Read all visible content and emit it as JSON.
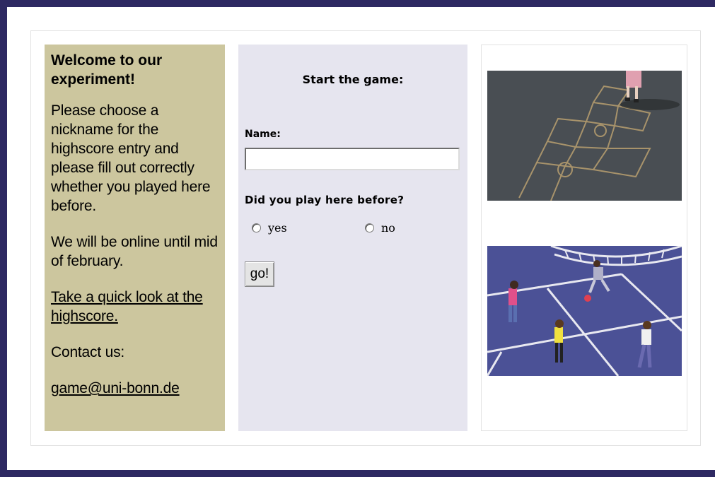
{
  "sidebar": {
    "welcome_title": "Welcome to our experiment!",
    "intro_text": "Please choose a nickname for the highscore entry and please fill out correctly whether you played here before.",
    "online_text": "We will be online until mid of february.",
    "highscore_link": "Take a quick look at the highscore.",
    "contact_label": "Contact us:",
    "contact_email": "game@uni-bonn.de"
  },
  "form": {
    "title": "Start the game:",
    "name_label": "Name:",
    "name_value": "",
    "played_before_label": "Did you play here before?",
    "options": [
      {
        "label": "yes",
        "checked": false
      },
      {
        "label": "no",
        "checked": false
      }
    ],
    "submit_label": "go!"
  },
  "images": {
    "top_description": "hopscotch-chalk-photo",
    "bottom_description": "children-playground-photo"
  },
  "colors": {
    "frame": "#2e2962",
    "sidebar_bg": "#ccc69e",
    "form_bg": "#e6e5ef"
  }
}
